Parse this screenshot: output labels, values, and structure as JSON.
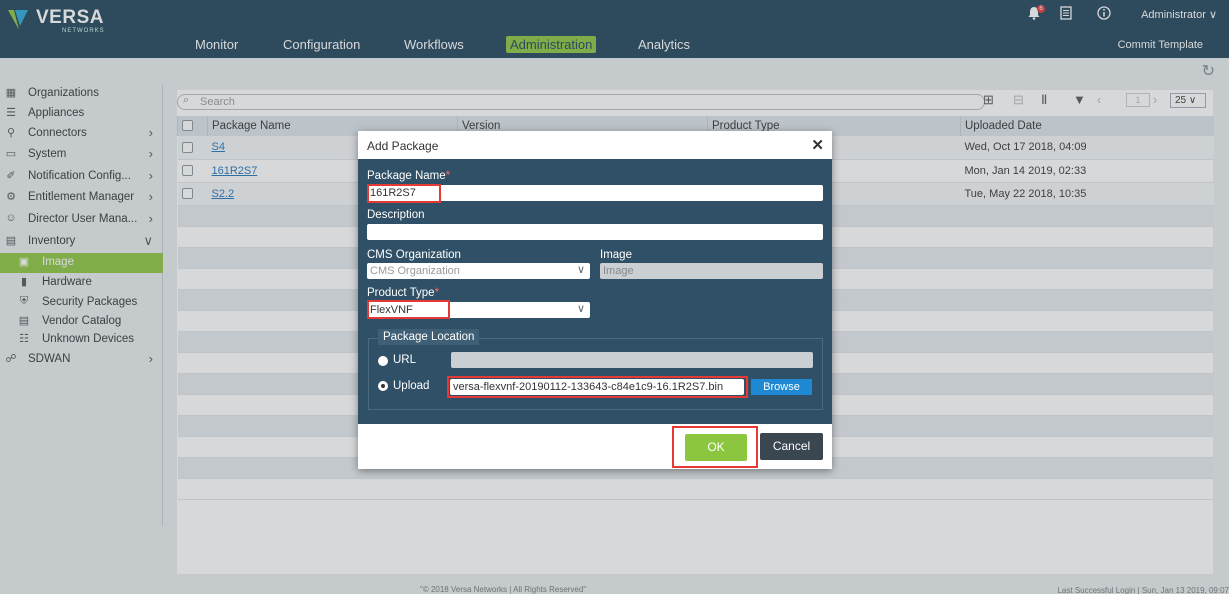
{
  "app": {
    "brand": "VERSA",
    "brand_sub": "NETWORKS",
    "user": "Administrator",
    "notification_count": "6"
  },
  "topnav": {
    "items": [
      "Monitor",
      "Configuration",
      "Workflows",
      "Administration",
      "Analytics"
    ],
    "active": "Administration",
    "commit_label": "Commit Template"
  },
  "sidebar": {
    "items": [
      {
        "label": "Organizations",
        "icon": "organizations-icon"
      },
      {
        "label": "Appliances",
        "icon": "appliances-icon"
      },
      {
        "label": "Connectors",
        "icon": "connectors-icon",
        "expandable": true
      },
      {
        "label": "System",
        "icon": "system-icon",
        "expandable": true
      },
      {
        "label": "Notification Config...",
        "icon": "notification-icon",
        "expandable": true
      },
      {
        "label": "Entitlement Manager",
        "icon": "entitlement-icon",
        "expandable": true
      },
      {
        "label": "Director User Mana...",
        "icon": "users-icon",
        "expandable": true
      },
      {
        "label": "Inventory",
        "icon": "inventory-icon",
        "expanded": true
      },
      {
        "label": "Image",
        "icon": "image-icon",
        "active": true
      },
      {
        "label": "Hardware",
        "icon": "hardware-icon"
      },
      {
        "label": "Security Packages",
        "icon": "shield-icon"
      },
      {
        "label": "Vendor Catalog",
        "icon": "catalog-icon"
      },
      {
        "label": "Unknown Devices",
        "icon": "unknown-devices-icon"
      },
      {
        "label": "SDWAN",
        "icon": "sdwan-icon",
        "expandable": true
      }
    ]
  },
  "table": {
    "search_placeholder": "Search",
    "page_number": "1",
    "page_size": "25",
    "columns": [
      "Package Name",
      "Version",
      "Product Type",
      "Uploaded Date"
    ],
    "rows": [
      {
        "name": "S4",
        "version": "",
        "type": "",
        "date": "Wed, Oct 17 2018, 04:09"
      },
      {
        "name": "161R2S7",
        "version": "",
        "type": "",
        "date": "Mon, Jan 14 2019, 02:33"
      },
      {
        "name": "S2.2",
        "version": "",
        "type": "",
        "date": "Tue, May 22 2018, 10:35"
      }
    ]
  },
  "modal": {
    "title": "Add Package",
    "package_name_label": "Package Name",
    "package_name_value": "161R2S7",
    "description_label": "Description",
    "description_value": "",
    "cms_org_label": "CMS Organization",
    "cms_org_placeholder": "CMS Organization",
    "image_label": "Image",
    "image_placeholder": "Image",
    "product_type_label": "Product Type",
    "product_type_value": "FlexVNF",
    "package_location_label": "Package Location",
    "url_label": "URL",
    "upload_label": "Upload",
    "upload_file": "versa-flexvnf-20190112-133643-c84e1c9-16.1R2S7.bin",
    "location_selected": "Upload",
    "browse_label": "Browse",
    "ok_label": "OK",
    "cancel_label": "Cancel"
  },
  "footer": {
    "copyright": "\"© 2018 Versa Networks | All Rights Reserved\"",
    "last_login": "Last Successful Login | Sun, Jan 13 2019, 09:07"
  },
  "colors": {
    "header": "#1f4258",
    "accent": "#8cc63f",
    "modal_body": "#2f5066",
    "highlight": "#e53935",
    "link": "#1f73b7"
  }
}
